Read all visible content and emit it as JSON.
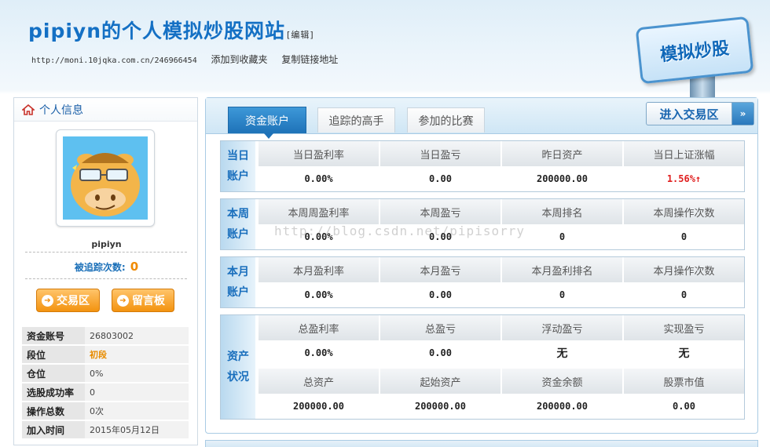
{
  "header": {
    "title": "pipiyn的个人模拟炒股网站",
    "edit_label": "编辑",
    "url": "http://moni.10jqka.com.cn/246966454",
    "add_favorite": "添加到收藏夹",
    "copy_link": "复制链接地址",
    "sign_label": "模拟炒股"
  },
  "sidebar": {
    "heading": "个人信息",
    "username": "pipiyn",
    "tracked_label": "被追踪次数:",
    "tracked_count": "0",
    "trade_btn": "交易区",
    "message_btn": "留言板",
    "info": [
      {
        "k": "资金账号",
        "v": "26803002"
      },
      {
        "k": "段位",
        "v": "初段"
      },
      {
        "k": "仓位",
        "v": "0%"
      },
      {
        "k": "选股成功率",
        "v": "0"
      },
      {
        "k": "操作总数",
        "v": "0次"
      },
      {
        "k": "加入时间",
        "v": "2015年05月12日"
      }
    ]
  },
  "tabs": [
    "资金账户",
    "追踪的高手",
    "参加的比赛"
  ],
  "enter_trade": "进入交易区",
  "day": {
    "side": [
      "当日",
      "账户"
    ],
    "headers": [
      "当日盈利率",
      "当日盈亏",
      "昨日资产",
      "当日上证涨幅"
    ],
    "values": [
      "0.00%",
      "0.00",
      "200000.00",
      "1.56%↑"
    ]
  },
  "week": {
    "side": [
      "本周",
      "账户"
    ],
    "headers": [
      "本周周盈利率",
      "本周盈亏",
      "本周排名",
      "本周操作次数"
    ],
    "values": [
      "0.00%",
      "0.00",
      "0",
      "0"
    ]
  },
  "month": {
    "side": [
      "本月",
      "账户"
    ],
    "headers": [
      "本月盈利率",
      "本月盈亏",
      "本月盈利排名",
      "本月操作次数"
    ],
    "values": [
      "0.00%",
      "0.00",
      "0",
      "0"
    ]
  },
  "assets": {
    "side": [
      "资产",
      "状况"
    ],
    "headers1": [
      "总盈利率",
      "总盈亏",
      "浮动盈亏",
      "实现盈亏"
    ],
    "values1": [
      "0.00%",
      "0.00",
      "无",
      "无"
    ],
    "headers2": [
      "总资产",
      "起始资产",
      "资金余额",
      "股票市值"
    ],
    "values2": [
      "200000.00",
      "200000.00",
      "200000.00",
      "0.00"
    ]
  },
  "watermark": "http://blog.csdn.net/pipisorry",
  "colors": {
    "accent": "#1470c4",
    "orange": "#f08a00",
    "up_red": "#e02020"
  }
}
